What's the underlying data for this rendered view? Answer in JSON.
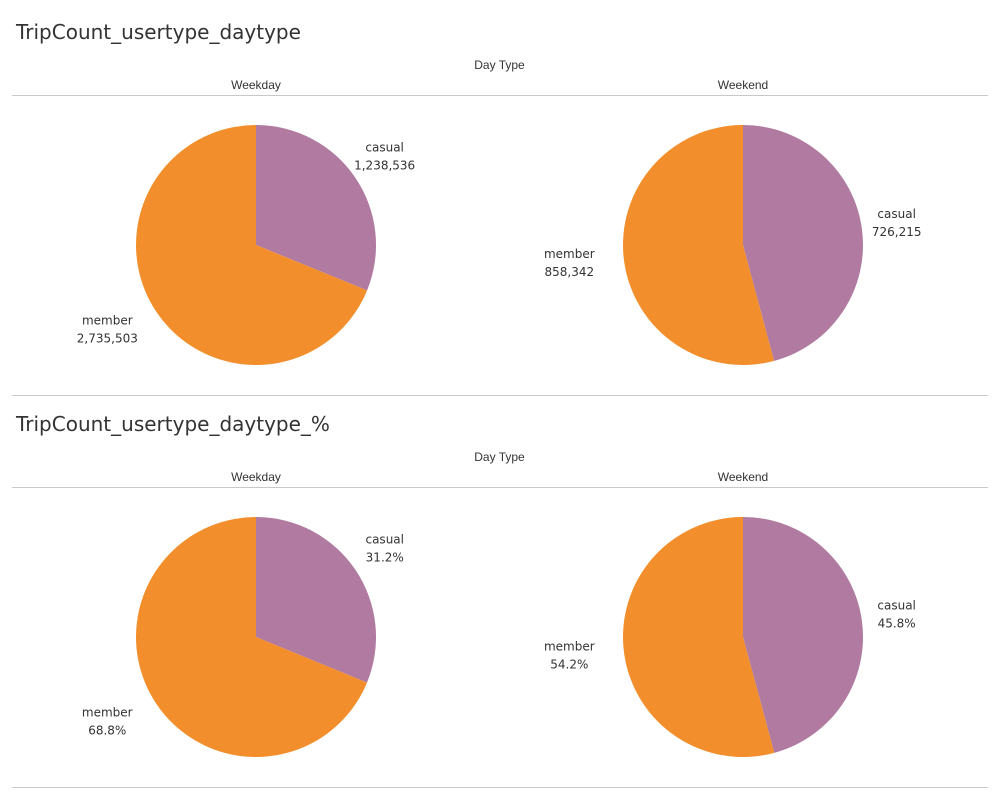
{
  "colors": {
    "casual": "#b07aa1",
    "member": "#f28e2b"
  },
  "chart_data": [
    {
      "type": "pie",
      "title": "TripCount_usertype_daytype",
      "column_axis_title": "Day Type",
      "panels": [
        {
          "header": "Weekday",
          "slices": [
            {
              "category": "casual",
              "value": 1238536,
              "label": "1,238,536"
            },
            {
              "category": "member",
              "value": 2735503,
              "label": "2,735,503"
            }
          ]
        },
        {
          "header": "Weekend",
          "slices": [
            {
              "category": "casual",
              "value": 726215,
              "label": "726,215"
            },
            {
              "category": "member",
              "value": 858342,
              "label": "858,342"
            }
          ]
        }
      ]
    },
    {
      "type": "pie",
      "title": "TripCount_usertype_daytype_%",
      "column_axis_title": "Day Type",
      "panels": [
        {
          "header": "Weekday",
          "slices": [
            {
              "category": "casual",
              "value": 31.2,
              "label": "31.2%"
            },
            {
              "category": "member",
              "value": 68.8,
              "label": "68.8%"
            }
          ]
        },
        {
          "header": "Weekend",
          "slices": [
            {
              "category": "casual",
              "value": 45.8,
              "label": "45.8%"
            },
            {
              "category": "member",
              "value": 54.2,
              "label": "54.2%"
            }
          ]
        }
      ]
    }
  ]
}
